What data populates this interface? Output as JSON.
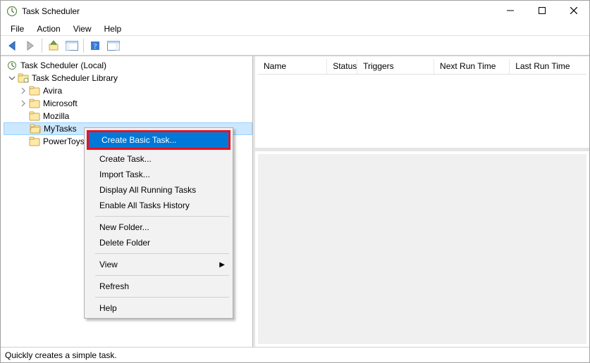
{
  "window": {
    "title": "Task Scheduler"
  },
  "menubar": {
    "items": [
      "File",
      "Action",
      "View",
      "Help"
    ]
  },
  "tree": {
    "root_label": "Task Scheduler (Local)",
    "library_label": "Task Scheduler Library",
    "children": [
      "Avira",
      "Microsoft",
      "Mozilla",
      "MyTasks",
      "PowerToys"
    ],
    "selected_index": 3
  },
  "list": {
    "columns": [
      {
        "label": "Name",
        "width": 108
      },
      {
        "label": "Status",
        "width": 46
      },
      {
        "label": "Triggers",
        "width": 120
      },
      {
        "label": "Next Run Time",
        "width": 118
      },
      {
        "label": "Last Run Time",
        "width": 120
      }
    ]
  },
  "context_menu": {
    "highlighted": "Create Basic Task...",
    "items": [
      "Create Task...",
      "Import Task...",
      "Display All Running Tasks",
      "Enable All Tasks History"
    ],
    "group2": [
      "New Folder...",
      "Delete Folder"
    ],
    "group3": [
      {
        "label": "View",
        "submenu": true
      }
    ],
    "group4": [
      "Refresh"
    ],
    "group5": [
      "Help"
    ]
  },
  "statusbar": {
    "text": "Quickly creates a simple task."
  }
}
